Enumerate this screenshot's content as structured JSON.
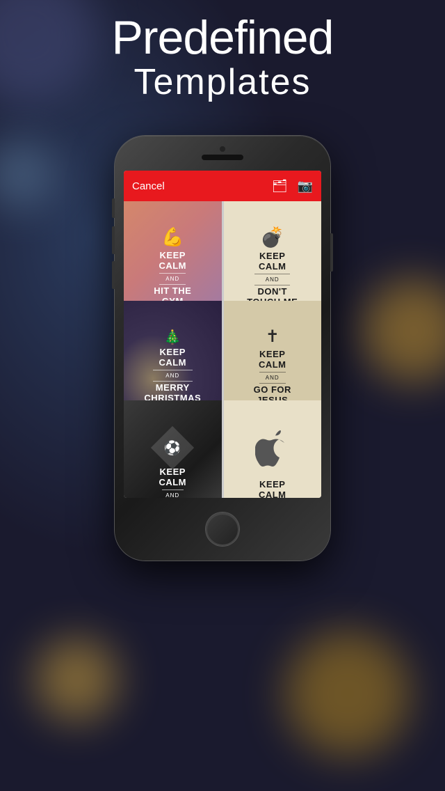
{
  "page": {
    "title_line1": "Predefined",
    "title_line2": "Templates"
  },
  "navbar": {
    "cancel_label": "Cancel",
    "folder_icon": "folder-icon",
    "camera_icon": "camera-icon"
  },
  "templates": [
    {
      "id": "gym",
      "icon": "💪",
      "icon_type": "muscle",
      "keep": "KEEP",
      "calm": "CALM",
      "and": "AND",
      "sub": "HIT THE GYM",
      "style": "gym",
      "text_color": "white"
    },
    {
      "id": "touch",
      "icon": "💣",
      "icon_type": "bomb",
      "keep": "KEEP",
      "calm": "CALM",
      "and": "AND",
      "sub": "DON'T TOUCH ME",
      "style": "touch",
      "text_color": "dark"
    },
    {
      "id": "xmas",
      "icon": "🎄",
      "icon_type": "xmas",
      "keep": "KEEP",
      "calm": "CALM",
      "and": "AND",
      "sub": "MERRY CHRISTMAS",
      "style": "xmas",
      "text_color": "white"
    },
    {
      "id": "jesus",
      "icon": "✝",
      "icon_type": "cross",
      "keep": "KEEP",
      "calm": "CALM",
      "and": "AND",
      "sub": "GO FOR JESUS",
      "style": "jesus",
      "text_color": "dark"
    },
    {
      "id": "soccer",
      "icon": "⚽",
      "icon_type": "soccer",
      "keep": "KEEP",
      "calm": "CALM",
      "and": "AND",
      "sub": "...",
      "style": "soccer",
      "text_color": "white"
    },
    {
      "id": "apple",
      "icon": "",
      "icon_type": "apple",
      "keep": "KEEP",
      "calm": "CALM",
      "and": "",
      "sub": "",
      "style": "apple",
      "text_color": "dark"
    }
  ]
}
